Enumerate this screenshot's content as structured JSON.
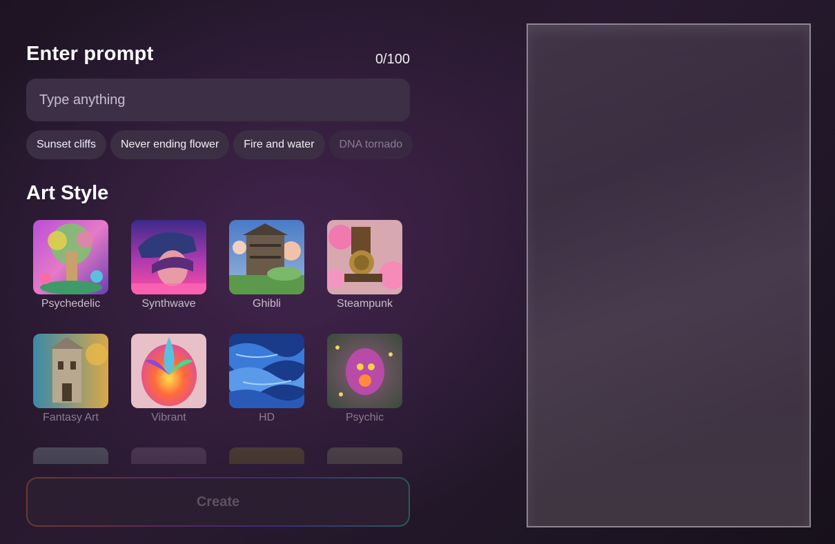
{
  "prompt": {
    "title": "Enter prompt",
    "char_count": "0/100",
    "input_value": "",
    "placeholder": "Type anything"
  },
  "suggestions": [
    {
      "label": "Sunset cliffs"
    },
    {
      "label": "Never ending flower"
    },
    {
      "label": "Fire and water"
    },
    {
      "label": "DNA tornado"
    }
  ],
  "art_style": {
    "title": "Art Style",
    "styles": [
      {
        "label": "Psychedelic"
      },
      {
        "label": "Synthwave"
      },
      {
        "label": "Ghibli"
      },
      {
        "label": "Steampunk"
      },
      {
        "label": "Fantasy Art"
      },
      {
        "label": "Vibrant"
      },
      {
        "label": "HD"
      },
      {
        "label": "Psychic"
      }
    ]
  },
  "create_button": {
    "label": "Create"
  },
  "colors": {
    "background": "#22172a",
    "input_background": "#3d2f45",
    "chip_background": "#3c2f44",
    "preview_border": "#8e8593"
  }
}
